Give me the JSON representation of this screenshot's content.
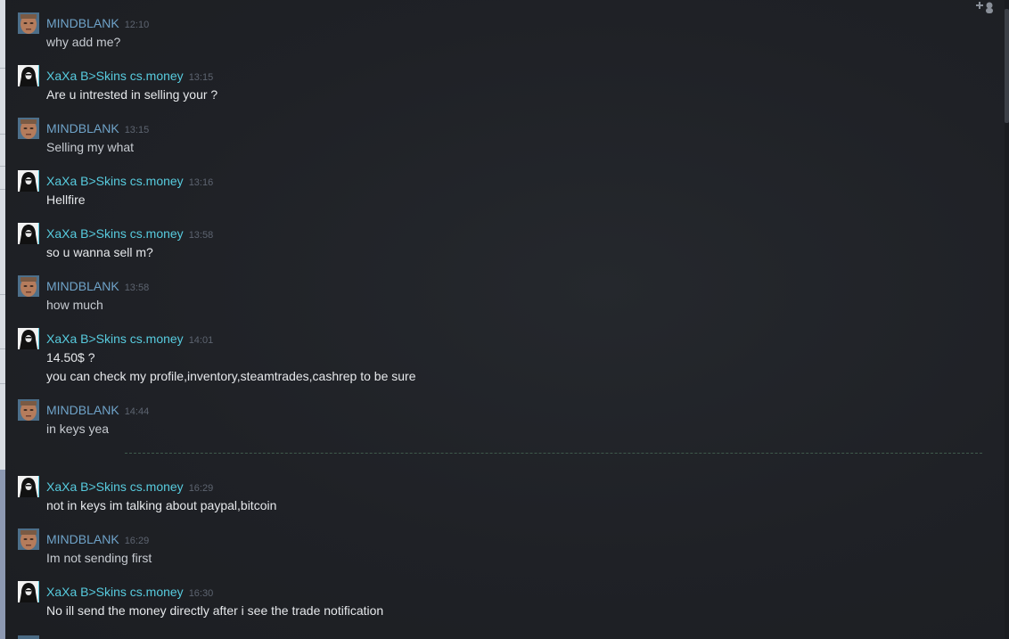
{
  "users": {
    "mindblank": {
      "name": "MINDBLANK",
      "color": "#6fa3c9"
    },
    "xaxa": {
      "name": "XaXa B>Skins cs.money",
      "color": "#57cbde"
    }
  },
  "messages": [
    {
      "user": "MINDBLANK",
      "time": "12:10",
      "lines": [
        "why add me?"
      ]
    },
    {
      "user": "XaXa B>Skins cs.money",
      "time": "13:15",
      "lines": [
        "Are u intrested in selling your ?"
      ]
    },
    {
      "user": "MINDBLANK",
      "time": "13:15",
      "lines": [
        "Selling my what"
      ]
    },
    {
      "user": "XaXa B>Skins cs.money",
      "time": "13:16",
      "lines": [
        "Hellfire"
      ]
    },
    {
      "user": "XaXa B>Skins cs.money",
      "time": "13:58",
      "lines": [
        "so u wanna sell m?"
      ]
    },
    {
      "user": "MINDBLANK",
      "time": "13:58",
      "lines": [
        "how much"
      ]
    },
    {
      "user": "XaXa B>Skins cs.money",
      "time": "14:01",
      "lines": [
        "14.50$ ?",
        "you can check my profile,inventory,steamtrades,cashrep to be sure"
      ]
    },
    {
      "user": "MINDBLANK",
      "time": "14:44",
      "lines": [
        "in keys yea"
      ]
    },
    {
      "user": "XaXa B>Skins cs.money",
      "time": "16:29",
      "lines": [
        "not in keys im talking about paypal,bitcoin"
      ]
    },
    {
      "user": "MINDBLANK",
      "time": "16:29",
      "lines": [
        "Im not sending first"
      ]
    },
    {
      "user": "XaXa B>Skins cs.money",
      "time": "16:30",
      "lines": [
        "No ill send the money directly after i see the trade notification"
      ]
    }
  ],
  "icons": {
    "invite": "add-friend-icon",
    "avatar_mindblank": "face-avatar",
    "avatar_xaxa": "hooded-figure-avatar"
  },
  "colors": {
    "background": "#1f2126",
    "message_text": "#c7cbd1",
    "timestamp": "#5d6470",
    "divider": "#3f5a4c"
  }
}
